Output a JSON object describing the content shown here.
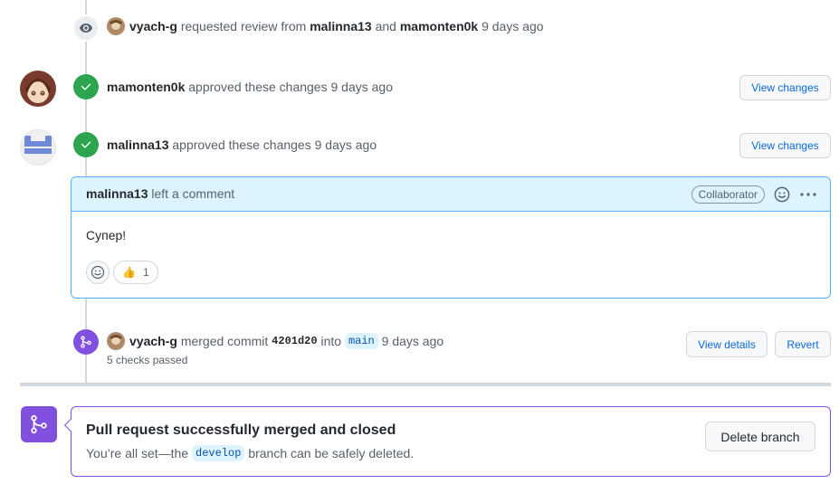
{
  "events": {
    "review_request": {
      "actor": "vyach-g",
      "action": "requested review from",
      "reviewer1": "malinna13",
      "conjunction": "and",
      "reviewer2": "mamonten0k",
      "time": "9 days ago"
    },
    "approval1": {
      "actor": "mamonten0k",
      "action": "approved these changes",
      "time": "9 days ago",
      "button": "View changes"
    },
    "approval2": {
      "actor": "malinna13",
      "action": "approved these changes",
      "time": "9 days ago",
      "button": "View changes"
    },
    "merge": {
      "actor": "vyach-g",
      "action": "merged commit",
      "commit": "4201d20",
      "into": "into",
      "branch": "main",
      "time": "9 days ago",
      "checks": "5 checks passed",
      "details_button": "View details",
      "revert_button": "Revert"
    }
  },
  "comment": {
    "author": "malinna13",
    "action": "left a comment",
    "role_badge": "Collaborator",
    "body": "Супер!",
    "reaction_emoji": "👍",
    "reaction_count": "1"
  },
  "merged_status": {
    "title": "Pull request successfully merged and closed",
    "subtitle_pre": "You’re all set—the",
    "branch": "develop",
    "subtitle_post": "branch can be safely deleted.",
    "delete_button": "Delete branch"
  },
  "colors": {
    "green": "#2da44e",
    "purple": "#8250df",
    "blue_link": "#0969da",
    "comment_border": "#54aeff",
    "comment_header_bg": "#ddf4ff"
  }
}
